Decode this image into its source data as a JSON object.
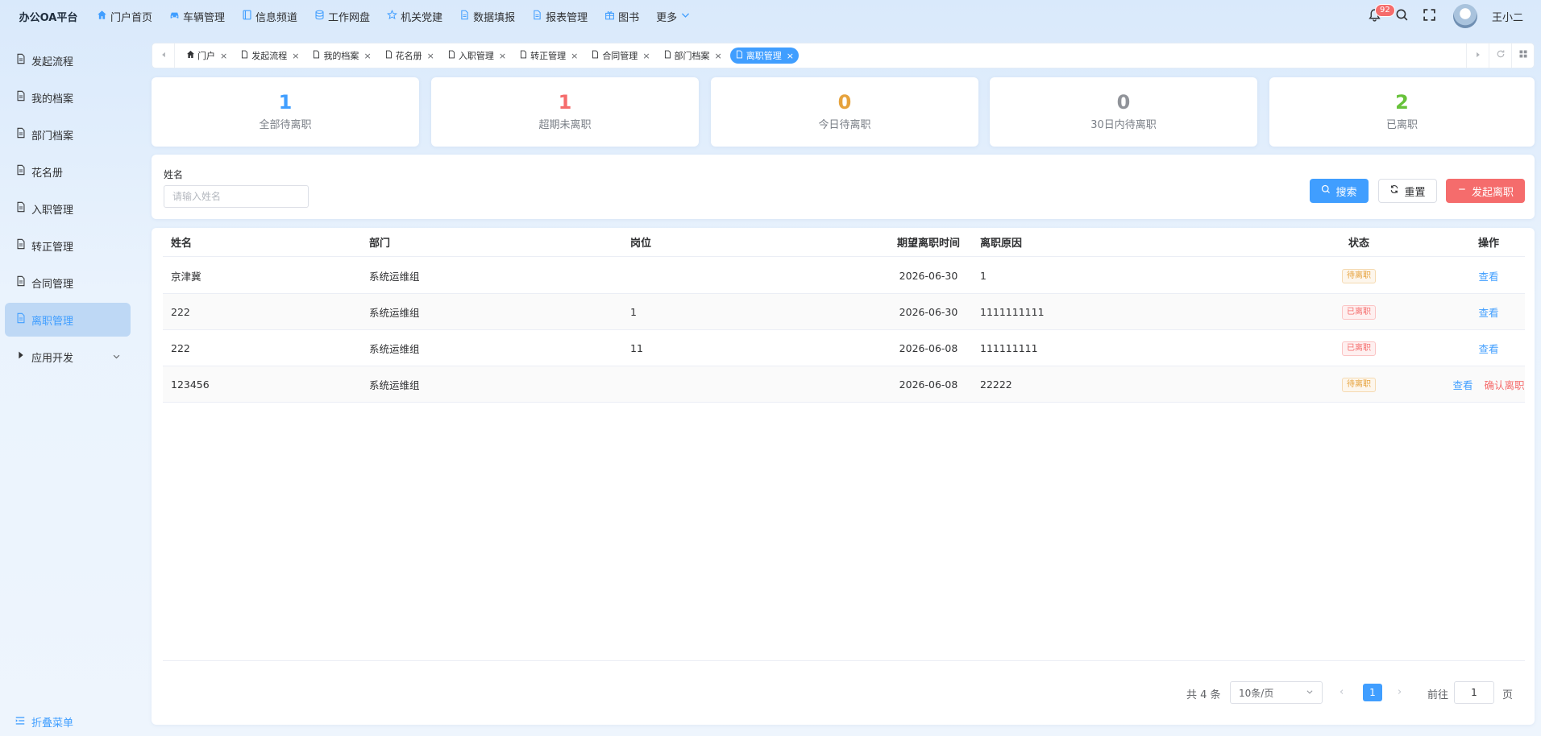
{
  "brand": "办公OA平台",
  "topnav": [
    {
      "label": "门户首页",
      "icon": "home-icon"
    },
    {
      "label": "车辆管理",
      "icon": "car-icon"
    },
    {
      "label": "信息频道",
      "icon": "book-icon"
    },
    {
      "label": "工作网盘",
      "icon": "database-icon"
    },
    {
      "label": "机关党建",
      "icon": "star-icon"
    },
    {
      "label": "数据填报",
      "icon": "document-icon"
    },
    {
      "label": "报表管理",
      "icon": "document-icon"
    },
    {
      "label": "图书",
      "icon": "gift-icon"
    },
    {
      "label": "更多",
      "icon": "chevron-down-icon"
    }
  ],
  "header": {
    "notification_count": "92",
    "username": "王小二"
  },
  "sidebar": {
    "items": [
      {
        "label": "发起流程"
      },
      {
        "label": "我的档案"
      },
      {
        "label": "部门档案"
      },
      {
        "label": "花名册"
      },
      {
        "label": "入职管理"
      },
      {
        "label": "转正管理"
      },
      {
        "label": "合同管理"
      },
      {
        "label": "离职管理"
      },
      {
        "label": "应用开发"
      }
    ],
    "collapse_label": "折叠菜单"
  },
  "tabs": [
    {
      "label": "门户"
    },
    {
      "label": "发起流程"
    },
    {
      "label": "我的档案"
    },
    {
      "label": "花名册"
    },
    {
      "label": "入职管理"
    },
    {
      "label": "转正管理"
    },
    {
      "label": "合同管理"
    },
    {
      "label": "部门档案"
    },
    {
      "label": "离职管理"
    }
  ],
  "tab_close": "×",
  "stats": [
    {
      "value": "1",
      "label": "全部待离职",
      "color": "#409eff"
    },
    {
      "value": "1",
      "label": "超期未离职",
      "color": "#f56c6c"
    },
    {
      "value": "0",
      "label": "今日待离职",
      "color": "#e6a23c"
    },
    {
      "value": "0",
      "label": "30日内待离职",
      "color": "#909399"
    },
    {
      "value": "2",
      "label": "已离职",
      "color": "#67c23a"
    }
  ],
  "search": {
    "name_label": "姓名",
    "name_placeholder": "请输入姓名",
    "search_btn": "搜索",
    "reset_btn": "重置",
    "start_btn": "发起离职"
  },
  "table": {
    "columns": {
      "name": "姓名",
      "dept": "部门",
      "post": "岗位",
      "date": "期望离职时间",
      "reason": "离职原因",
      "status": "状态",
      "ops": "操作"
    },
    "rows": [
      {
        "name": "京津冀",
        "dept": "系统运维组",
        "post": "",
        "date": "2026-06-30",
        "reason": "1",
        "status": "待离职",
        "view": "查看",
        "confirm": ""
      },
      {
        "name": "222",
        "dept": "系统运维组",
        "post": "1",
        "date": "2026-06-30",
        "reason": "1111111111",
        "status": "已离职",
        "view": "查看",
        "confirm": ""
      },
      {
        "name": "222",
        "dept": "系统运维组",
        "post": "11",
        "date": "2026-06-08",
        "reason": "111111111",
        "status": "已离职",
        "view": "查看",
        "confirm": ""
      },
      {
        "name": "123456",
        "dept": "系统运维组",
        "post": "",
        "date": "2026-06-08",
        "reason": "22222",
        "status": "待离职",
        "view": "查看",
        "confirm": "确认离职"
      }
    ]
  },
  "pagination": {
    "total_text": "共 4 条",
    "page_size": "10条/页",
    "prev": "‹",
    "current_page": "1",
    "next": "›",
    "goto_label": "前往",
    "goto_value": "1",
    "page_suffix": "页"
  }
}
